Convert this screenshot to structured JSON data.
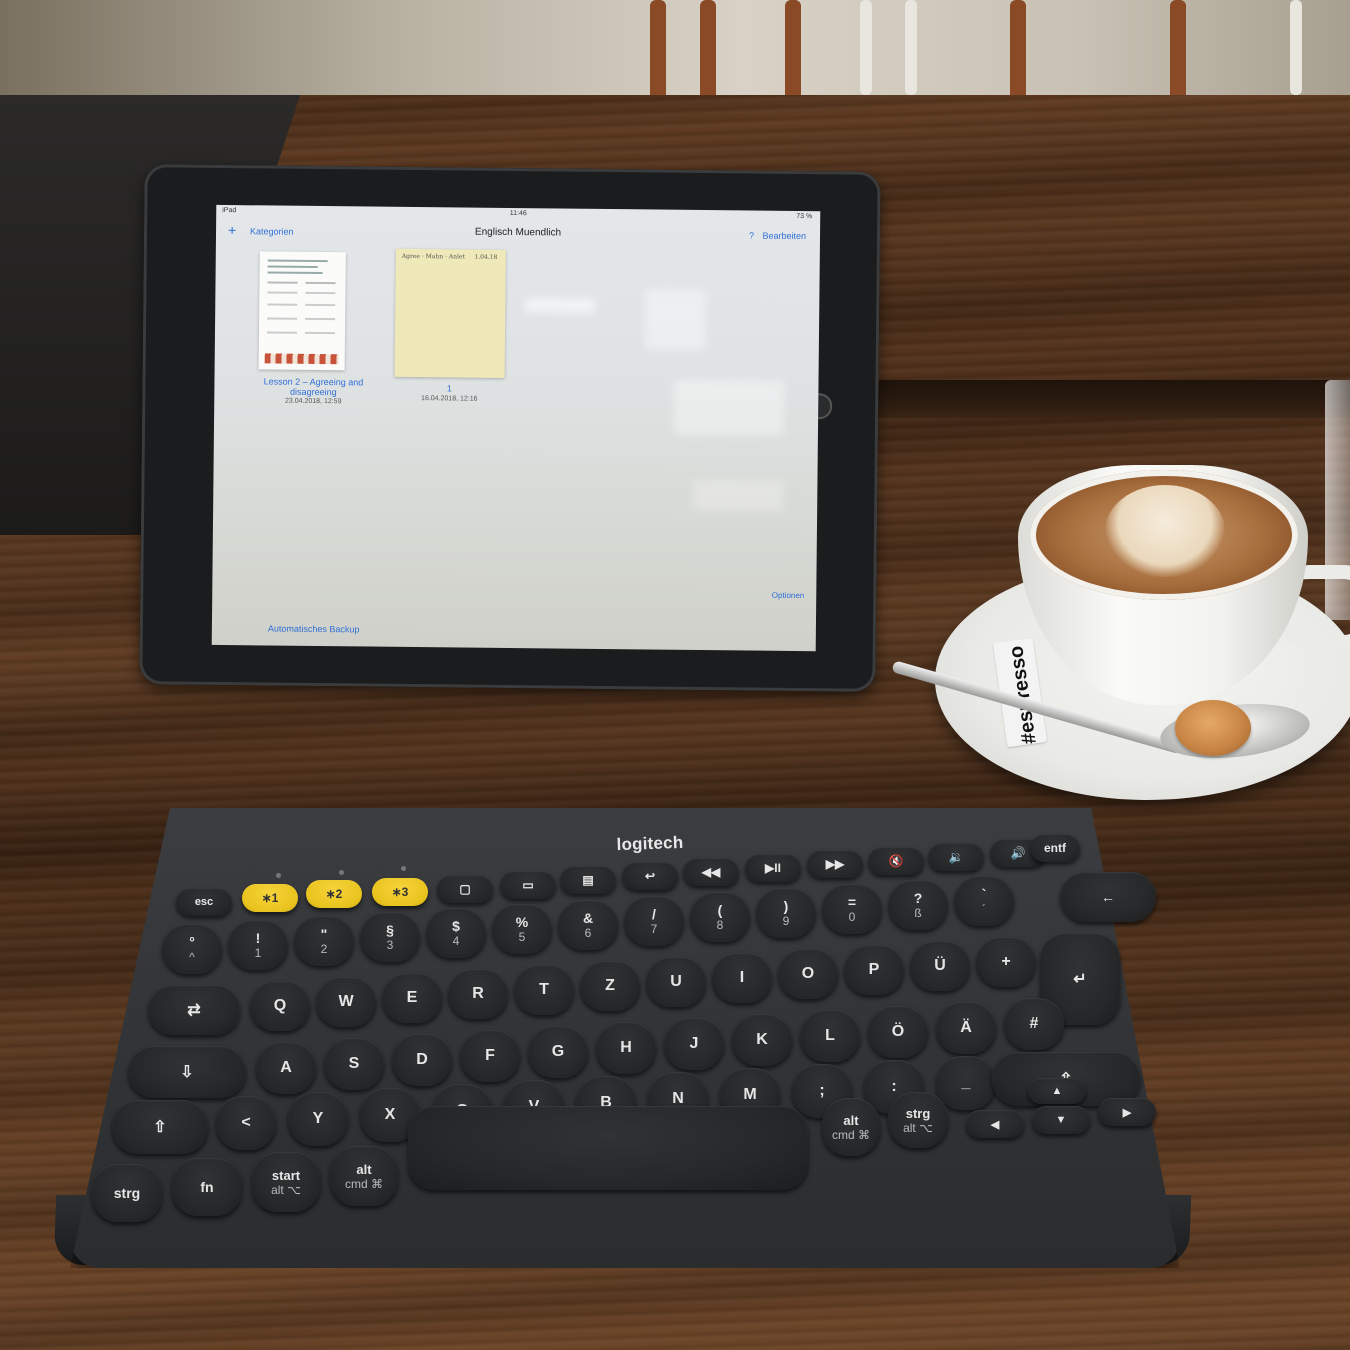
{
  "ipad": {
    "status": {
      "carrier": "iPad",
      "time": "11:46",
      "battery": "73 %"
    },
    "navbar": {
      "plus": "+",
      "left": "Kategorien",
      "title": "Englisch Muendlich",
      "help": "?",
      "right": "Bearbeiten"
    },
    "documents": [
      {
        "title": "Lesson 2 – Agreeing and disagreeing",
        "date": "23.04.2018, 12:59"
      },
      {
        "title": "1",
        "date": "16.04.2018, 12:16"
      }
    ],
    "options_label": "Optionen",
    "backup_label": "Automatisches Backup"
  },
  "keyboard": {
    "brand": "logitech",
    "keys": {
      "fn_row": [
        "esc",
        "∗1",
        "∗2",
        "∗3",
        "▢",
        "▭",
        "▤",
        "↩",
        "◀◀",
        "▶II",
        "▶▶",
        "🔇",
        "🔉",
        "🔊",
        "entf"
      ],
      "num_row": [
        "°",
        "!",
        "\"",
        "§",
        "$",
        "%",
        "&",
        "/",
        "(",
        ")",
        "=",
        "?",
        "`",
        "←"
      ],
      "num_row_lower": [
        "^",
        "1",
        "2",
        "3",
        "4",
        "5",
        "6",
        "7",
        "8",
        "9",
        "0",
        "ß",
        "´"
      ],
      "q_row": [
        "⇄",
        "Q",
        "W",
        "E",
        "R",
        "T",
        "Z",
        "U",
        "I",
        "O",
        "P",
        "Ü",
        "+",
        "↵"
      ],
      "a_row": [
        "⇩",
        "A",
        "S",
        "D",
        "F",
        "G",
        "H",
        "J",
        "K",
        "L",
        "Ö",
        "Ä",
        "#"
      ],
      "y_row": [
        "⇧",
        "<",
        "Y",
        "X",
        "C",
        "V",
        "B",
        "N",
        "M",
        ";",
        ":",
        "_",
        "⇧"
      ],
      "bottom_row": [
        "strg",
        "fn",
        "start",
        "alt",
        "",
        "alt",
        "strg",
        "◀",
        "▲",
        "▼",
        "▶"
      ],
      "bottom_sub": {
        "start": "alt ⌥",
        "alt_left": "cmd ⌘",
        "alt_right": "cmd ⌘",
        "strg_right": "alt ⌥"
      }
    }
  },
  "sugar_stick_text": "#espresso"
}
